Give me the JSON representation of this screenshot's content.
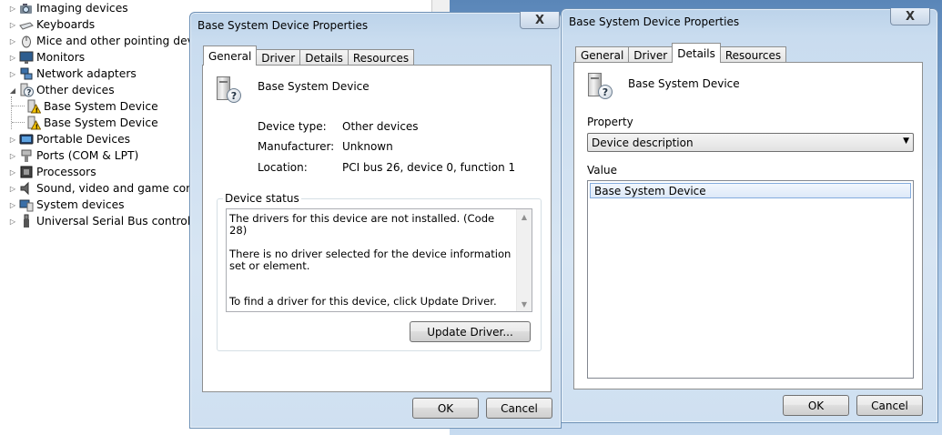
{
  "device_tree": {
    "items": [
      {
        "label": "Imaging devices",
        "icon": "camera-icon",
        "expander": "collapsed",
        "indent": 0
      },
      {
        "label": "Keyboards",
        "icon": "keyboard-icon",
        "expander": "collapsed",
        "indent": 0
      },
      {
        "label": "Mice and other pointing devices",
        "icon": "mouse-icon",
        "expander": "collapsed",
        "indent": 0
      },
      {
        "label": "Monitors",
        "icon": "monitor-icon",
        "expander": "collapsed",
        "indent": 0
      },
      {
        "label": "Network adapters",
        "icon": "network-icon",
        "expander": "collapsed",
        "indent": 0
      },
      {
        "label": "Other devices",
        "icon": "unknown-device-icon",
        "expander": "expanded",
        "indent": 0
      },
      {
        "label": "Base System Device",
        "icon": "warning-device-icon",
        "expander": "none",
        "indent": 1
      },
      {
        "label": "Base System Device",
        "icon": "warning-device-icon",
        "expander": "none",
        "indent": 1
      },
      {
        "label": "Portable Devices",
        "icon": "portable-device-icon",
        "expander": "collapsed",
        "indent": 0
      },
      {
        "label": "Ports (COM & LPT)",
        "icon": "port-icon",
        "expander": "collapsed",
        "indent": 0
      },
      {
        "label": "Processors",
        "icon": "processor-icon",
        "expander": "collapsed",
        "indent": 0
      },
      {
        "label": "Sound, video and game controllers",
        "icon": "speaker-icon",
        "expander": "collapsed",
        "indent": 0
      },
      {
        "label": "System devices",
        "icon": "system-device-icon",
        "expander": "collapsed",
        "indent": 0
      },
      {
        "label": "Universal Serial Bus controllers",
        "icon": "usb-icon",
        "expander": "collapsed",
        "indent": 0
      }
    ]
  },
  "dialog_general": {
    "title": "Base System Device Properties",
    "close_label": "X",
    "tabs": [
      "General",
      "Driver",
      "Details",
      "Resources"
    ],
    "active_tab": "General",
    "device_name": "Base System Device",
    "fields": [
      {
        "label": "Device type:",
        "value": "Other devices"
      },
      {
        "label": "Manufacturer:",
        "value": "Unknown"
      },
      {
        "label": "Location:",
        "value": "PCI bus 26, device 0, function 1"
      }
    ],
    "status_group_label": "Device status",
    "status_text": "The drivers for this device are not installed. (Code 28)\n\nThere is no driver selected for the device information set or element.\n\n\nTo find a driver for this device, click Update Driver.",
    "update_driver_label": "Update Driver...",
    "ok_label": "OK",
    "cancel_label": "Cancel"
  },
  "dialog_details": {
    "title": "Base System Device Properties",
    "close_label": "X",
    "tabs": [
      "General",
      "Driver",
      "Details",
      "Resources"
    ],
    "active_tab": "Details",
    "device_name": "Base System Device",
    "property_label": "Property",
    "property_value": "Device description",
    "value_label": "Value",
    "value_items": [
      "Base System Device"
    ],
    "ok_label": "OK",
    "cancel_label": "Cancel"
  }
}
